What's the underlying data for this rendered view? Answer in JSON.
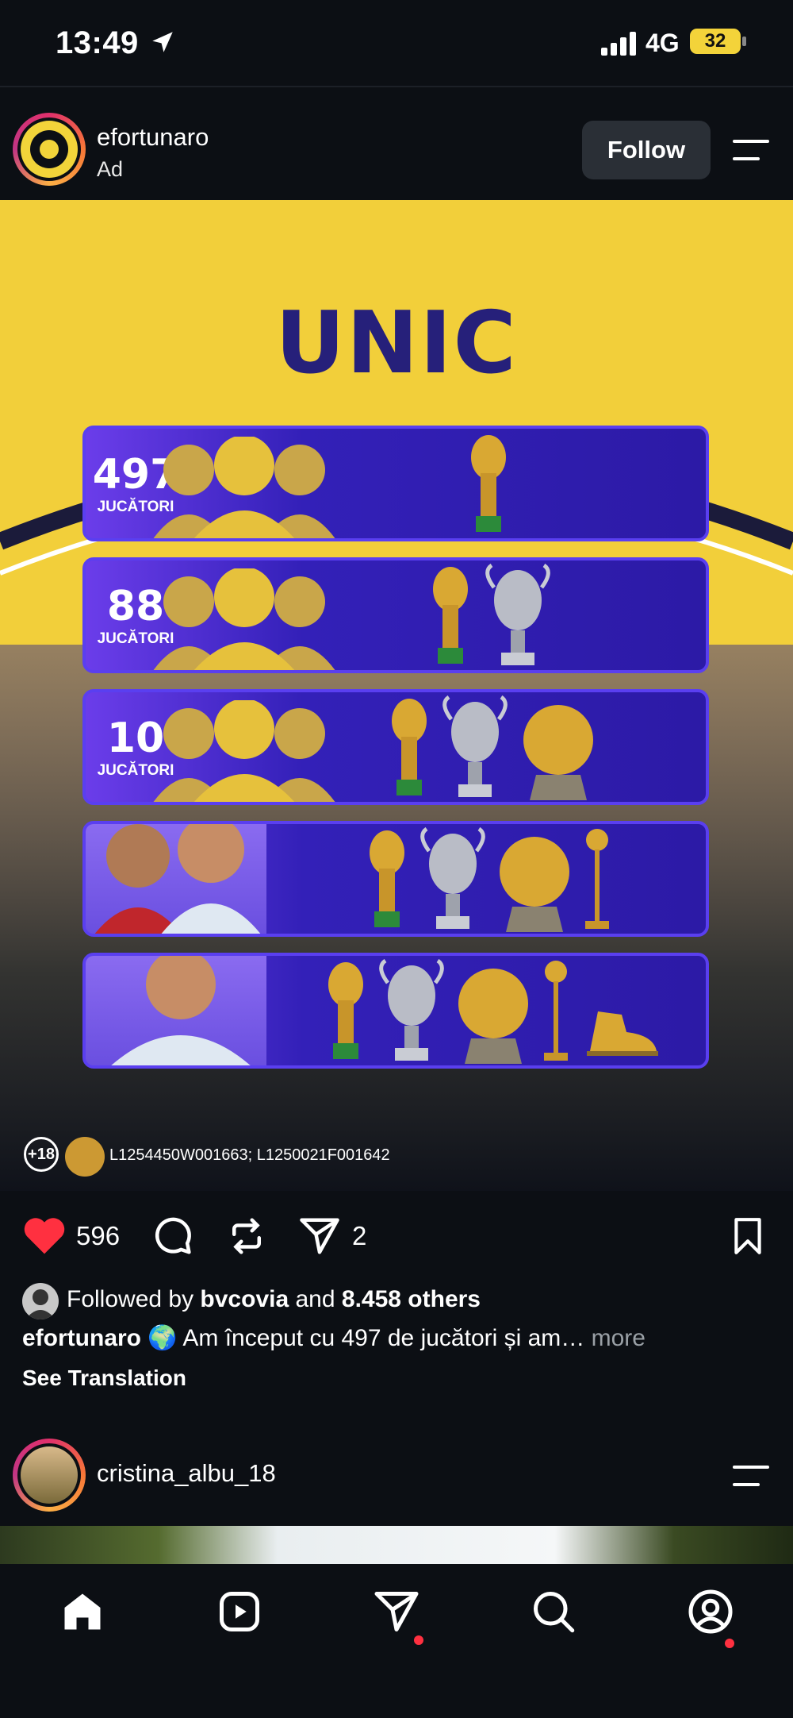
{
  "status_bar": {
    "time": "13:49",
    "network": "4G",
    "battery": "32"
  },
  "post": {
    "username": "efortunaro",
    "sponsored_label": "Ad",
    "follow_label": "Follow",
    "image": {
      "title": "UNIC",
      "rows": [
        {
          "number": "497",
          "sublabel": "JUCĂTORI"
        },
        {
          "number": "88",
          "sublabel": "JUCĂTORI"
        },
        {
          "number": "10",
          "sublabel": "JUCĂTORI"
        }
      ],
      "age_badge": "+18",
      "license_text": "L1254450W001663; L1250021F001642"
    },
    "likes": "596",
    "shares": "2",
    "followed_by_prefix": "Followed by ",
    "followed_by_user": "bvcovia",
    "followed_by_and": " and ",
    "followed_by_others": "8.458 others",
    "caption_user": "efortunaro",
    "caption_emoji": "🌍",
    "caption_text": " Am început cu 497 de jucători și am…",
    "caption_more": " more",
    "see_translation": "See Translation"
  },
  "next_post": {
    "username": "cristina_albu_18"
  },
  "colors": {
    "background": "#0c0f14",
    "accent_yellow": "#f2cf3a",
    "purple": "#2c1aa6",
    "like_red": "#ff3040"
  }
}
